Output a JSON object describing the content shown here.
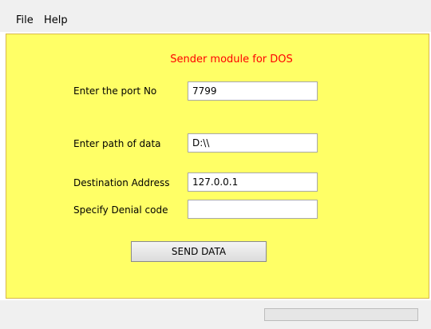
{
  "menubar": {
    "items": [
      {
        "label": "File"
      },
      {
        "label": "Help"
      }
    ]
  },
  "panel": {
    "title": "Sender module for DOS",
    "background_color": "#ffff66",
    "title_color": "#ff0000",
    "fields": {
      "port": {
        "label": "Enter the port No",
        "value": "7799"
      },
      "path": {
        "label": "Enter path of data",
        "value": "D:\\\\"
      },
      "destination": {
        "label": "Destination Address",
        "value": "127.0.0.1"
      },
      "denial": {
        "label": "Specify Denial code",
        "value": ""
      }
    },
    "send_button_label": "SEND DATA"
  },
  "statusbar": {
    "progress_fraction": 0
  }
}
